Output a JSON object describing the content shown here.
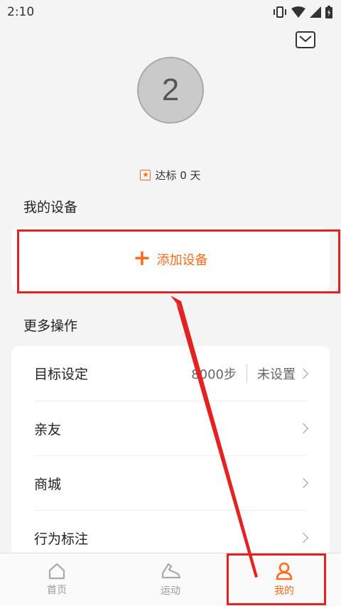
{
  "status_bar": {
    "time": "2:10"
  },
  "profile": {
    "avatar_text": "2",
    "goal_text": "达标 0 天"
  },
  "sections": {
    "my_devices_title": "我的设备",
    "more_actions_title": "更多操作"
  },
  "add_device": {
    "label": "添加设备",
    "plus": "+"
  },
  "menu": [
    {
      "label": "目标设定",
      "steps": "8000步",
      "status": "未设置"
    },
    {
      "label": "亲友"
    },
    {
      "label": "商城"
    },
    {
      "label": "行为标注"
    }
  ],
  "bottom_nav": {
    "items": [
      {
        "label": "首页",
        "icon": "home-icon"
      },
      {
        "label": "运动",
        "icon": "shoe-icon"
      },
      {
        "label": "我的",
        "icon": "person-icon",
        "active": true
      }
    ]
  },
  "colors": {
    "accent": "#ff6a1a",
    "annotation": "#e52222"
  }
}
